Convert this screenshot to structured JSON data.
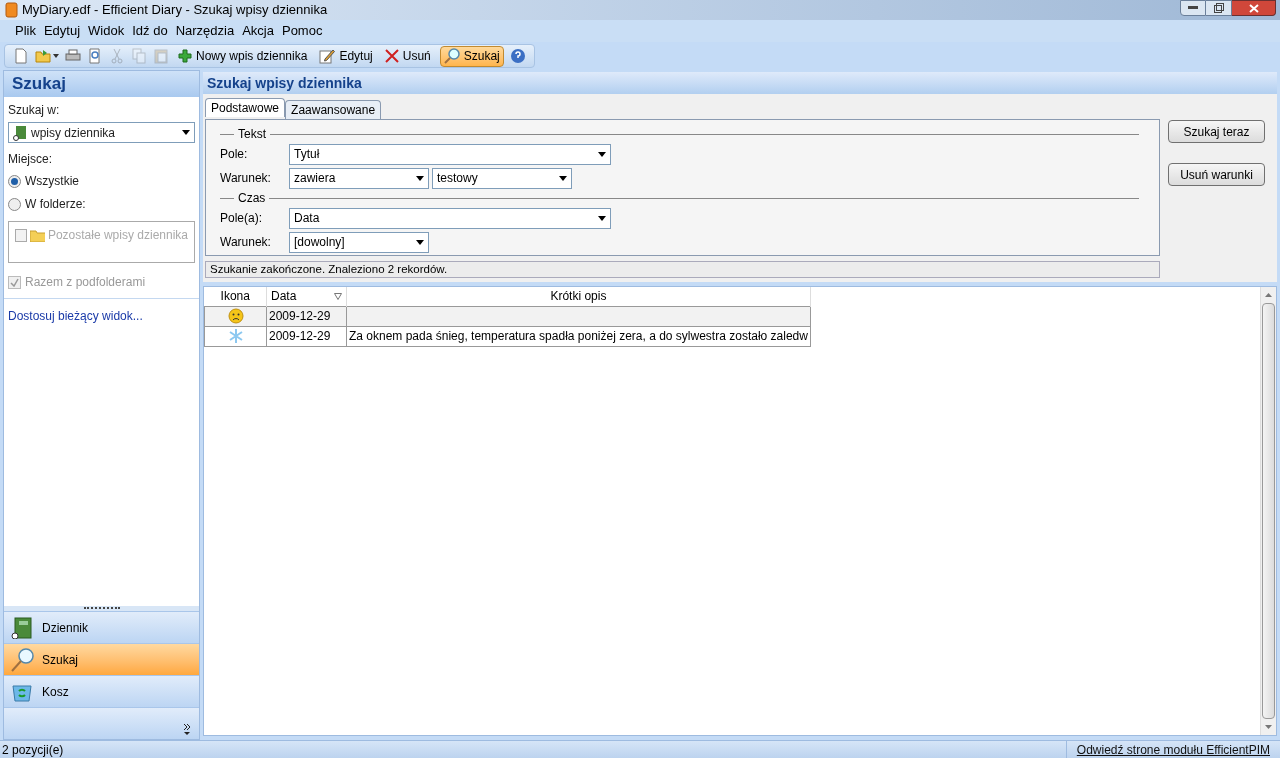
{
  "window": {
    "title": "MyDiary.edf - Efficient Diary - Szukaj wpisy dziennika"
  },
  "menu": [
    "Plik",
    "Edytuj",
    "Widok",
    "Idź do",
    "Narzędzia",
    "Akcja",
    "Pomoc"
  ],
  "toolbar": [
    {
      "kind": "new",
      "disabled": false
    },
    {
      "kind": "open",
      "disabled": false
    },
    {
      "kind": "print",
      "disabled": false
    },
    {
      "kind": "preview",
      "disabled": false
    },
    {
      "kind": "cut",
      "disabled": true
    },
    {
      "kind": "copy",
      "disabled": true
    },
    {
      "kind": "paste",
      "disabled": true
    },
    {
      "kind": "add",
      "label": "Nowy wpis dziennika",
      "selected": false
    },
    {
      "kind": "edit",
      "label": "Edytuj",
      "selected": false
    },
    {
      "kind": "delete",
      "label": "Usuń",
      "selected": false
    },
    {
      "kind": "search",
      "label": "Szukaj",
      "selected": true
    },
    {
      "kind": "help",
      "disabled": false
    }
  ],
  "sidebar": {
    "title": "Szukaj",
    "search_in_label": "Szukaj w:",
    "search_in_value": "wpisy dziennika",
    "place_label": "Miejsce:",
    "place_options": [
      {
        "label": "Wszystkie",
        "selected": true
      },
      {
        "label": "W folderze:",
        "selected": false
      }
    ],
    "folders": [
      {
        "label": "Pozostałe wpisy dziennika",
        "checked": false
      }
    ],
    "include_subfolders": {
      "label": "Razem z podfolderami",
      "checked": true,
      "disabled": true
    },
    "customize_link": "Dostosuj bieżący widok...",
    "nav": [
      {
        "kind": "diary",
        "label": "Dziennik",
        "selected": false
      },
      {
        "kind": "search",
        "label": "Szukaj",
        "selected": true
      },
      {
        "kind": "trash",
        "label": "Kosz",
        "selected": false
      }
    ]
  },
  "main": {
    "title": "Szukaj wpisy dziennika",
    "tabs": [
      {
        "label": "Podstawowe",
        "selected": true
      },
      {
        "label": "Zaawansowane",
        "selected": false
      }
    ],
    "sections": [
      {
        "legend": "Tekst",
        "rows": [
          {
            "label": "Pole:",
            "fields": [
              {
                "value": "Tytuł",
                "wide": true
              }
            ]
          },
          {
            "label": "Warunek:",
            "fields": [
              {
                "value": "zawiera",
                "wide": false
              },
              {
                "value": "testowy",
                "wide": false
              }
            ]
          }
        ]
      },
      {
        "legend": "Czas",
        "rows": [
          {
            "label": "Pole(a):",
            "fields": [
              {
                "value": "Data",
                "wide": true
              }
            ]
          },
          {
            "label": "Warunek:",
            "fields": [
              {
                "value": "[dowolny]",
                "wide": false
              }
            ]
          }
        ]
      }
    ],
    "buttons": [
      "Szukaj teraz",
      "Usuń warunki"
    ],
    "status": "Szukanie zakończone. Znaleziono 2 rekordów.",
    "table": {
      "columns": [
        {
          "label": "Ikona",
          "sorted": false
        },
        {
          "label": "Data",
          "sorted": true
        },
        {
          "label": "Krótki opis",
          "sorted": false
        }
      ],
      "rows": [
        {
          "kind": "sad",
          "date": "2009-12-29",
          "description": ""
        },
        {
          "kind": "snow",
          "date": "2009-12-29",
          "description": "Za oknem pada śnieg, temperatura spadła poniżej zera, a do sylwestra zostało zaledw"
        }
      ]
    }
  },
  "status_bar": {
    "count": "2 pozycji(e)",
    "link": "Odwiedź strone modułu EfficientPIM"
  }
}
